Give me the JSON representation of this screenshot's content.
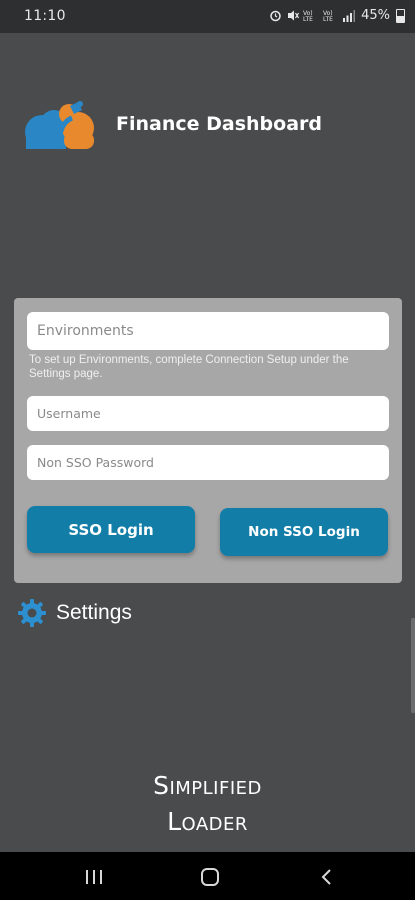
{
  "status_bar": {
    "time": "11:10",
    "battery": "45%",
    "icons": [
      "alarm-icon",
      "mute-icon",
      "volte-icon",
      "wifi-icon",
      "signal-icon",
      "battery-icon"
    ]
  },
  "app": {
    "title": "Finance Dashboard"
  },
  "login": {
    "environments_placeholder": "Environments",
    "environments_hint": "To set up Environments, complete Connection Setup under the Settings page.",
    "username_placeholder": "Username",
    "password_placeholder": "Non SSO Password",
    "sso_button": "SSO Login",
    "non_sso_button": "Non SSO Login"
  },
  "settings": {
    "label": "Settings"
  },
  "brand": {
    "line1": "Simplified",
    "line2": "Loader"
  },
  "colors": {
    "background": "#4a4b4d",
    "card": "#a7a7a7",
    "button": "#127ea8",
    "logo_blue": "#2a86c4",
    "logo_orange": "#e8892e",
    "gear": "#2c8fd0"
  }
}
